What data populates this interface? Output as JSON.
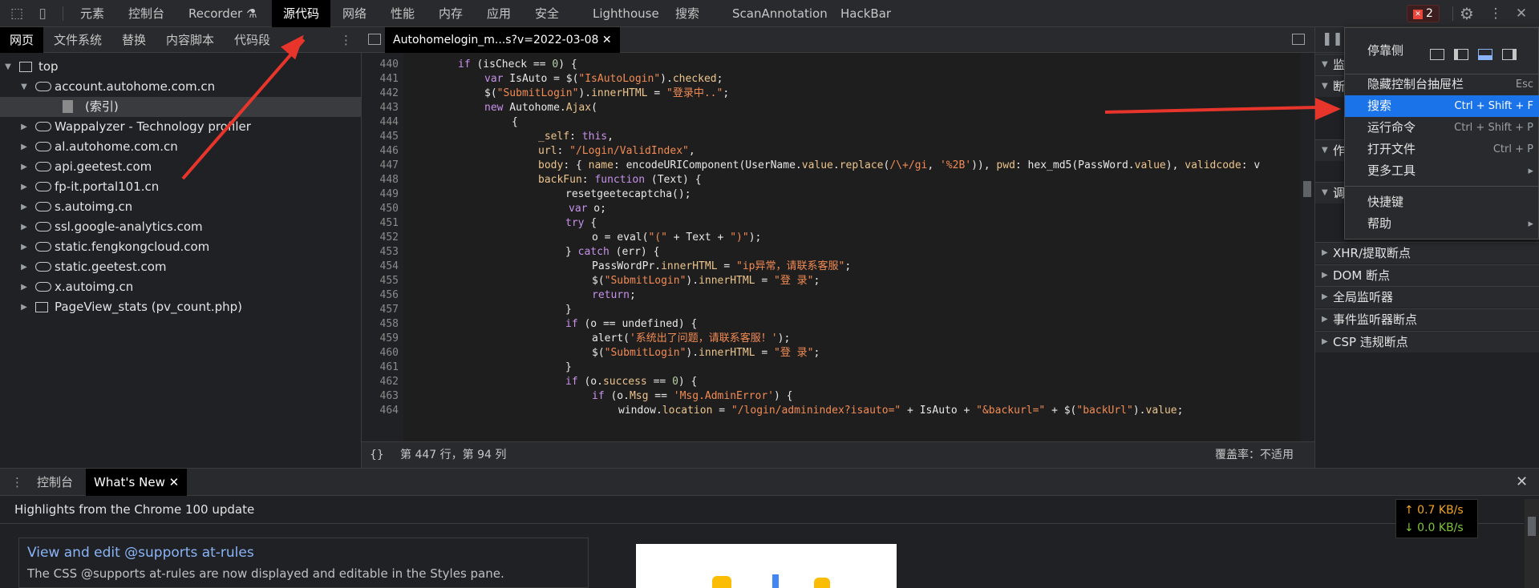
{
  "top_toolbar": {
    "tabs": [
      "元素",
      "控制台",
      "Recorder",
      "源代码",
      "网络",
      "性能",
      "内存",
      "应用",
      "安全",
      "Lighthouse",
      "搜索",
      "ScanAnnotation",
      "HackBar"
    ],
    "active_tab": "源代码",
    "error_count": "2"
  },
  "navigator": {
    "tabs": [
      "网页",
      "文件系统",
      "替换",
      "内容脚本",
      "代码段"
    ],
    "active_tab": "网页",
    "tree": [
      {
        "label": "top",
        "type": "frame",
        "expanded": true
      },
      {
        "label": "account.autohome.com.cn",
        "type": "domain",
        "expanded": true
      },
      {
        "label": "(索引)",
        "type": "file",
        "selected": true
      },
      {
        "label": "Wappalyzer - Technology profiler",
        "type": "domain"
      },
      {
        "label": "al.autohome.com.cn",
        "type": "domain"
      },
      {
        "label": "api.geetest.com",
        "type": "domain"
      },
      {
        "label": "fp-it.portal101.cn",
        "type": "domain"
      },
      {
        "label": "s.autoimg.cn",
        "type": "domain"
      },
      {
        "label": "ssl.google-analytics.com",
        "type": "domain"
      },
      {
        "label": "static.fengkongcloud.com",
        "type": "domain"
      },
      {
        "label": "static.geetest.com",
        "type": "domain"
      },
      {
        "label": "x.autoimg.cn",
        "type": "domain"
      },
      {
        "label": "PageView_stats (pv_count.php)",
        "type": "frame"
      }
    ]
  },
  "editor": {
    "file_tab": "Autohomelogin_m...s?v=2022-03-08",
    "line_numbers": [
      "440",
      "441",
      "442",
      "443",
      "444",
      "445",
      "446",
      "447",
      "448",
      "449",
      "450",
      "451",
      "452",
      "453",
      "454",
      "455",
      "456",
      "457",
      "458",
      "459",
      "460",
      "461",
      "462",
      "463",
      "464"
    ],
    "status_position": "第 447 行，第 94 列",
    "coverage": "覆盖率：不适用",
    "format_button": "{}"
  },
  "right_pane": {
    "sections": [
      "监",
      "断",
      "作",
      "调",
      "XHR/提取断点",
      "DOM 断点",
      "全局监听器",
      "事件监听器断点",
      "CSP 违规断点"
    ]
  },
  "menu": {
    "dock_label": "停靠侧",
    "items": [
      {
        "label": "隐藏控制台抽屉栏",
        "shortcut": "Esc"
      },
      {
        "label": "搜索",
        "shortcut": "Ctrl + Shift + F",
        "highlighted": true
      },
      {
        "label": "运行命令",
        "shortcut": "Ctrl + Shift + P"
      },
      {
        "label": "打开文件",
        "shortcut": "Ctrl + P"
      },
      {
        "label": "更多工具",
        "shortcut": "▸"
      },
      {
        "label": "快捷键",
        "shortcut": ""
      },
      {
        "label": "帮助",
        "shortcut": "▸"
      }
    ]
  },
  "drawer": {
    "tabs": [
      "控制台",
      "What's New"
    ],
    "active_tab": "What's New",
    "headline": "Highlights from the Chrome 100 update",
    "card_title": "View and edit @supports at-rules",
    "card_desc": "The CSS @supports at-rules are now displayed and editable in the Styles pane.",
    "net_up": "↑ 0.7 KB/s",
    "net_down": "↓ 0.0 KB/s"
  },
  "colors": {
    "menu_highlight": "#1a73e8",
    "annotation_arrow": "#e8352b",
    "net_up": "#f5a623",
    "net_down": "#7cc83a"
  }
}
